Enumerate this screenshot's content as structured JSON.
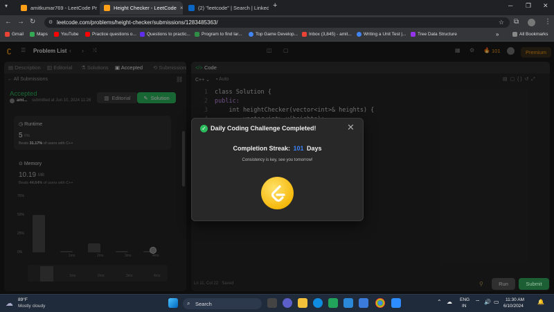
{
  "browser": {
    "tabs": [
      {
        "label": "amitkumar769 - LeetCode Pro",
        "close": "×"
      },
      {
        "label": "Height Checker - LeetCode",
        "close": "×"
      },
      {
        "label": "(2) \"leetcode\" | Search | LinkedIn",
        "close": "×"
      }
    ],
    "new_tab": "+",
    "url": "leetcode.com/problems/height-checker/submissions/1283485363/",
    "bookmarks": [
      "Gmail",
      "Maps",
      "YouTube",
      "Practice questions o...",
      "Questions to practic...",
      "Program to find lar...",
      "Top Game Develop...",
      "Inbox (3,845) - amit...",
      "Writing a Unit Test |...",
      "Tree Data Structure"
    ],
    "all_bookmarks": "All Bookmarks"
  },
  "header": {
    "problem_list": "Problem List",
    "streak_count": "101",
    "premium": "Premium"
  },
  "left": {
    "tabs": [
      "Description",
      "Editorial",
      "Solutions",
      "Accepted",
      "Submissions"
    ],
    "all_submissions": "All Submissions",
    "status": "Accepted",
    "author": "ami...",
    "submitted": "submitted at Jun 10, 2024 11:26",
    "editorial_btn": "Editorial",
    "solution_btn": "Solution",
    "runtime_label": "Runtime",
    "runtime_value": "5",
    "runtime_unit": "ms",
    "runtime_beats_prefix": "Beats",
    "runtime_beats": "31.17%",
    "runtime_beats_suffix": "of users with C++",
    "memory_label": "Memory",
    "memory_value": "10.19",
    "memory_unit": "MB",
    "memory_beats_prefix": "Beats",
    "memory_beats": "44.64%",
    "memory_beats_suffix": "of users with C++",
    "y_ticks": [
      "75%",
      "50%",
      "25%",
      "0%"
    ],
    "x_ticks": [
      "1ms",
      "2ms",
      "3ms",
      "4ms"
    ],
    "x_ticks_bottom": [
      "1ms",
      "2ms",
      "3ms",
      "4ms"
    ]
  },
  "distribution": {
    "bars": [
      50,
      2,
      12,
      2,
      2
    ]
  },
  "editor": {
    "title": "Code",
    "language": "C++",
    "auto": "Auto",
    "lines": [
      {
        "n": "1",
        "code": "class Solution {"
      },
      {
        "n": "2",
        "code": "public:"
      },
      {
        "n": "3",
        "code": "    int heightChecker(vector<int>& heights) {"
      },
      {
        "n": "4",
        "code": "        vector<int> v(heights);"
      }
    ],
    "cursor": "Ln 11, Col 22",
    "saved": "Saved",
    "run": "Run",
    "submit": "Submit"
  },
  "modal": {
    "title": "Daily Coding Challenge Completed!",
    "streak_label": "Completion Streak:",
    "streak_value": "101",
    "streak_unit": "Days",
    "message": "Consistency is key, see you tomorrow!"
  },
  "taskbar": {
    "weather_temp": "89°F",
    "weather_desc": "Mostly cloudy",
    "search": "Search",
    "lang1": "ENG",
    "lang2": "IN",
    "time": "11:30 AM",
    "date": "6/10/2024"
  },
  "colors": {
    "accent": "#ffa116",
    "success": "#2cbb5d",
    "streak_blue": "#3b82f6"
  }
}
